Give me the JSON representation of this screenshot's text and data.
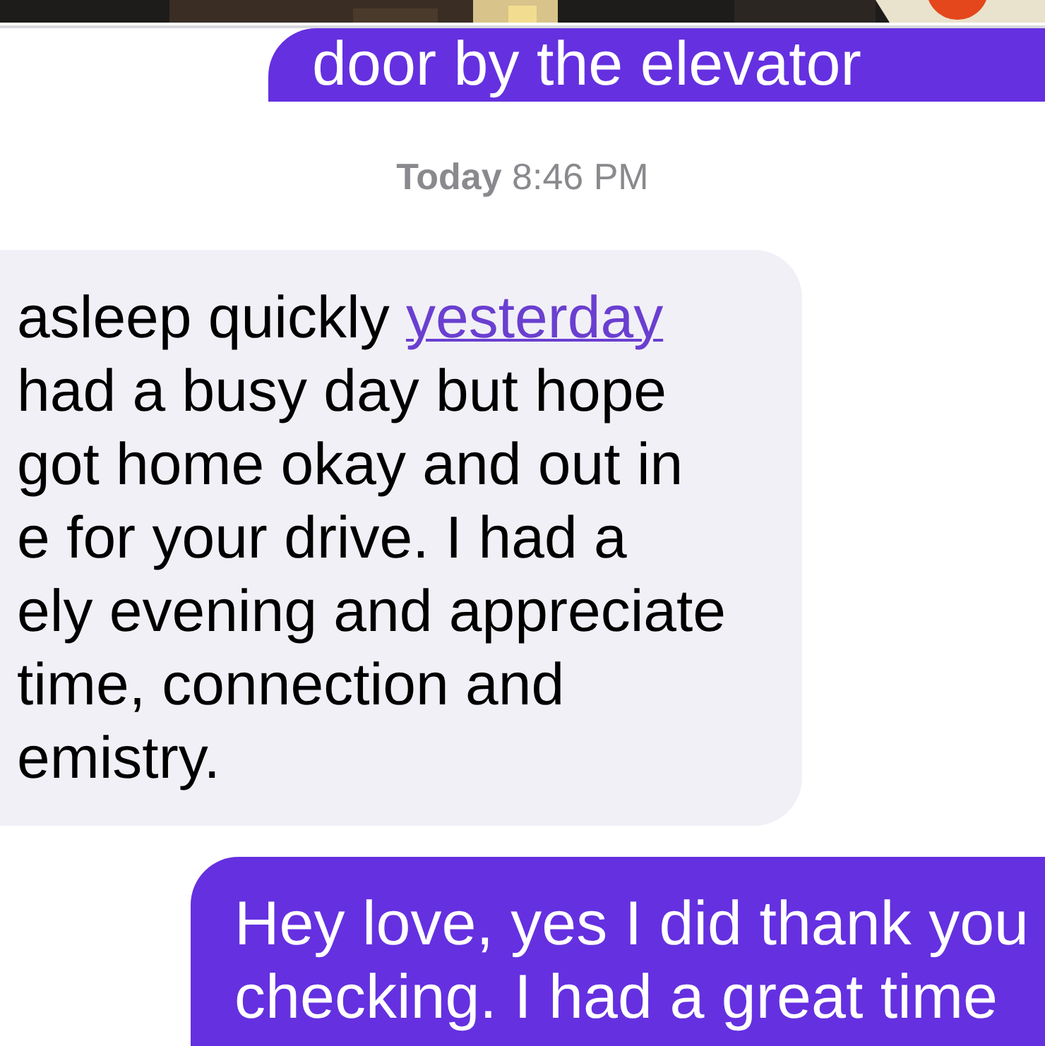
{
  "top_message": {
    "text": "door by the elevator",
    "outgoing": true
  },
  "timestamp": {
    "day": "Today",
    "time": "8:46 PM"
  },
  "messages": [
    {
      "outgoing": false,
      "lines": [
        [
          {
            "text": "asleep quickly "
          },
          {
            "text": "yesterday",
            "link": true
          }
        ],
        [
          {
            "text": "had a busy day but hope"
          }
        ],
        [
          {
            "text": "got home okay and out in"
          }
        ],
        [
          {
            "text": "e for your drive. I had a"
          }
        ],
        [
          {
            "text": "ely evening and appreciate"
          }
        ],
        [
          {
            "text": "time, connection and"
          }
        ],
        [
          {
            "text": "emistry."
          }
        ]
      ]
    },
    {
      "outgoing": true,
      "lines": [
        [
          {
            "text": "Hey love, yes I did thank you"
          }
        ],
        [
          {
            "text": "checking. I had a great time"
          }
        ]
      ]
    }
  ]
}
